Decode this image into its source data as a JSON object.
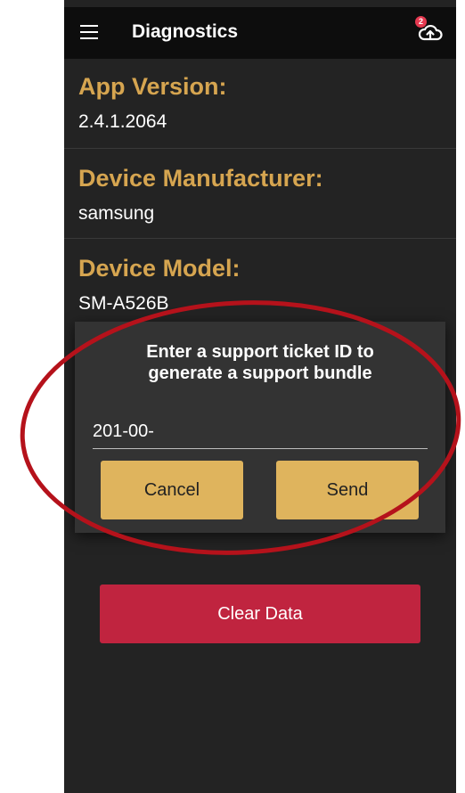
{
  "app_bar": {
    "title": "Diagnostics",
    "menu_icon": "hamburger-menu-icon",
    "upload_icon": "cloud-upload-icon",
    "badge_count": "2"
  },
  "sections": {
    "app_version": {
      "label": "App Version:",
      "value": "2.4.1.2064"
    },
    "manufacturer": {
      "label": "Device Manufacturer:",
      "value": "samsung"
    },
    "model": {
      "label": "Device Model:",
      "value": "SM-A526B"
    }
  },
  "dialog": {
    "title_line1": "Enter a support ticket ID to",
    "title_line2": "generate a support bundle",
    "input_value": "201-00-",
    "cancel_label": "Cancel",
    "send_label": "Send"
  },
  "clear_button_label": "Clear Data",
  "colors": {
    "accent_gold": "#d6a550",
    "button_gold": "#dfb45d",
    "danger_red": "#c0243f",
    "annotation_red": "#b5121b"
  }
}
